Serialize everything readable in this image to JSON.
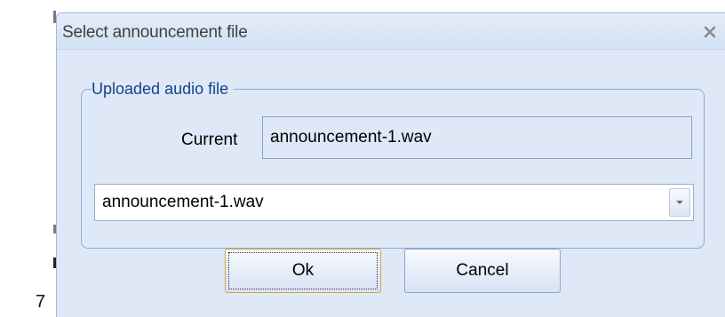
{
  "background": {
    "page_fragment": "7"
  },
  "dialog": {
    "title": "Select announcement file",
    "close_icon": "close-icon",
    "fieldset": {
      "legend": "Uploaded audio file",
      "current_label": "Current",
      "current_value": "announcement-1.wav"
    },
    "combo": {
      "selected_value": "announcement-1.wav",
      "trigger_icon": "chevron-down-icon"
    },
    "buttons": {
      "ok": "Ok",
      "cancel": "Cancel"
    }
  },
  "colors": {
    "dialog_bg": "#dfe8f6",
    "border_blue": "#99bbe8",
    "legend_text": "#15428b",
    "focus_border": "#d5a43c"
  }
}
